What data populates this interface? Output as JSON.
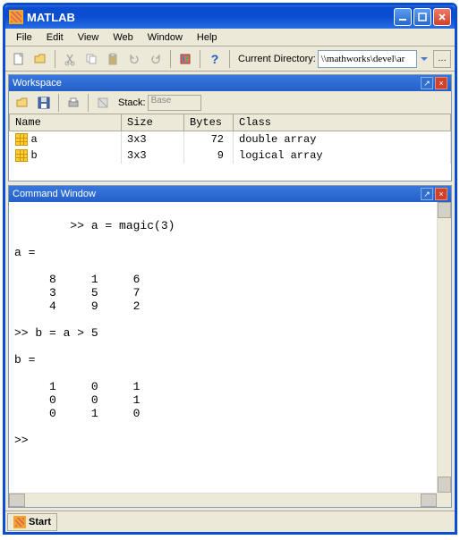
{
  "title": "MATLAB",
  "menubar": [
    "File",
    "Edit",
    "View",
    "Web",
    "Window",
    "Help"
  ],
  "toolbar": {
    "dir_label": "Current Directory:",
    "dir_value": "\\\\mathworks\\devel\\ar"
  },
  "workspace": {
    "title": "Workspace",
    "stack_label": "Stack:",
    "stack_value": "Base",
    "columns": [
      "Name",
      "Size",
      "Bytes",
      "Class"
    ],
    "vars": [
      {
        "name": "a",
        "size": "3x3",
        "bytes": "72",
        "class": "double array"
      },
      {
        "name": "b",
        "size": "3x3",
        "bytes": "9",
        "class": "logical array"
      }
    ]
  },
  "command": {
    "title": "Command Window",
    "content": ">> a = magic(3)\n\na =\n\n     8     1     6\n     3     5     7\n     4     9     2\n\n>> b = a > 5\n\nb =\n\n     1     0     1\n     0     0     1\n     0     1     0\n\n>> "
  },
  "start": "Start"
}
